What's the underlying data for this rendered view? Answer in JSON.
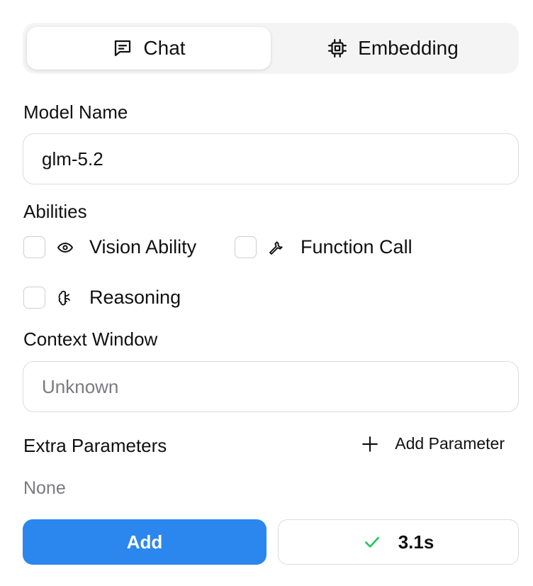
{
  "tabs": [
    {
      "label": "Chat",
      "icon": "chat-icon",
      "active": true
    },
    {
      "label": "Embedding",
      "icon": "chip-icon",
      "active": false
    }
  ],
  "model_name": {
    "label": "Model Name",
    "value": "glm-5.2"
  },
  "abilities": {
    "label": "Abilities",
    "items": [
      {
        "label": "Vision Ability",
        "icon": "eye-icon",
        "checked": false
      },
      {
        "label": "Function Call",
        "icon": "wrench-icon",
        "checked": false
      },
      {
        "label": "Reasoning",
        "icon": "brain-icon",
        "checked": false
      }
    ]
  },
  "context_window": {
    "label": "Context Window",
    "placeholder": "Unknown"
  },
  "extra_parameters": {
    "label": "Extra Parameters",
    "add_label": "Add Parameter",
    "empty_text": "None"
  },
  "actions": {
    "add_label": "Add",
    "status_label": "3.1s"
  },
  "colors": {
    "accent": "#2b87ee",
    "success": "#22c55e"
  }
}
